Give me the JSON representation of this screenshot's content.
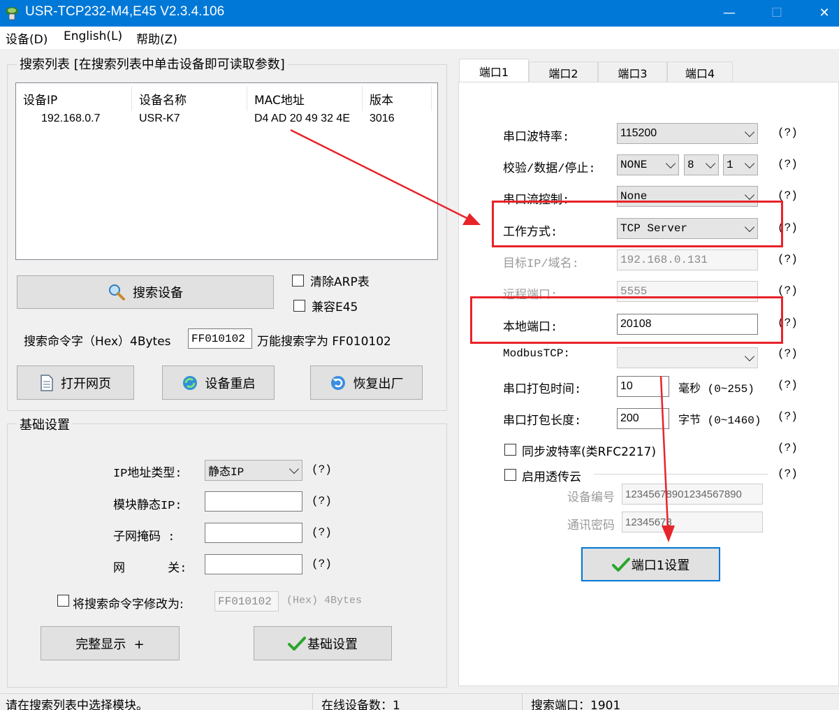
{
  "window": {
    "title": "USR-TCP232-M4,E45 V2.3.4.106",
    "minimize": "—",
    "maximize": "☐",
    "close": "✕"
  },
  "menu": [
    "设备(D)",
    "English(L)",
    "帮助(Z)"
  ],
  "search": {
    "group_title": "搜索列表 [在搜索列表中单击设备即可读取参数]",
    "columns": [
      "设备IP",
      "设备名称",
      "MAC地址",
      "版本"
    ],
    "rows": [
      {
        "ip": "192.168.0.7",
        "name": "USR-K7",
        "mac": "D4 AD 20 49 32 4E",
        "version": "3016"
      }
    ],
    "search_button": "搜索设备",
    "clear_arp": "清除ARP表",
    "compat_e45": "兼容E45",
    "cmd_label": "搜索命令字（Hex）4Bytes",
    "cmd_value": "FF010102",
    "cmd_hint": "万能搜索字为 FF010102",
    "open_web": "打开网页",
    "restart": "设备重启",
    "factory_reset": "恢复出厂"
  },
  "basic": {
    "group_title": "基础设置",
    "ip_type_label": "IP地址类型:",
    "ip_type_value": "静态IP",
    "static_ip_label": "模块静态IP:",
    "subnet_label": "子网掩码 :",
    "gateway_label": "网      关:",
    "help": "(?)",
    "modify_cmd_label": "将搜索命令字修改为:",
    "modify_cmd_value": "FF010102",
    "modify_cmd_unit": "(Hex) 4Bytes",
    "full_display": "完整显示  +",
    "basic_settings": "基础设置"
  },
  "tabs": [
    "端口1",
    "端口2",
    "端口3",
    "端口4"
  ],
  "port": {
    "baud_label": "串口波特率:",
    "baud_value": "115200",
    "parity_label": "校验/数据/停止:",
    "parity_value": "NONE",
    "data_bits": "8",
    "stop_bits": "1",
    "flow_label": "串口流控制:",
    "flow_value": "None",
    "mode_label": "工作方式:",
    "mode_value": "TCP Server",
    "target_label": "目标IP/域名:",
    "target_value": "192.168.0.131",
    "remote_port_label": "远程端口:",
    "remote_port_value": "5555",
    "local_port_label": "本地端口:",
    "local_port_value": "20108",
    "modbus_label": "ModbusTCP:",
    "pack_time_label": "串口打包时间:",
    "pack_time_value": "10",
    "pack_time_unit": "毫秒 (0~255)",
    "pack_len_label": "串口打包长度:",
    "pack_len_value": "200",
    "pack_len_unit": "字节 (0~1460)",
    "sync_baud": "同步波特率(类RFC2217)",
    "cloud": "启用透传云",
    "device_id_label": "设备编号",
    "device_id_value": "12345678901234567890",
    "comm_pwd_label": "通讯密码",
    "comm_pwd_value": "12345678",
    "help": "(?)",
    "apply_button": "端口1设置"
  },
  "status": {
    "hint": "请在搜索列表中选择模块。",
    "online": "在线设备数：1",
    "search_port": "搜索端口：1901"
  },
  "colors": {
    "titlebar": "#0078d7",
    "annotation": "#e8232a",
    "check": "#2aa52a"
  }
}
